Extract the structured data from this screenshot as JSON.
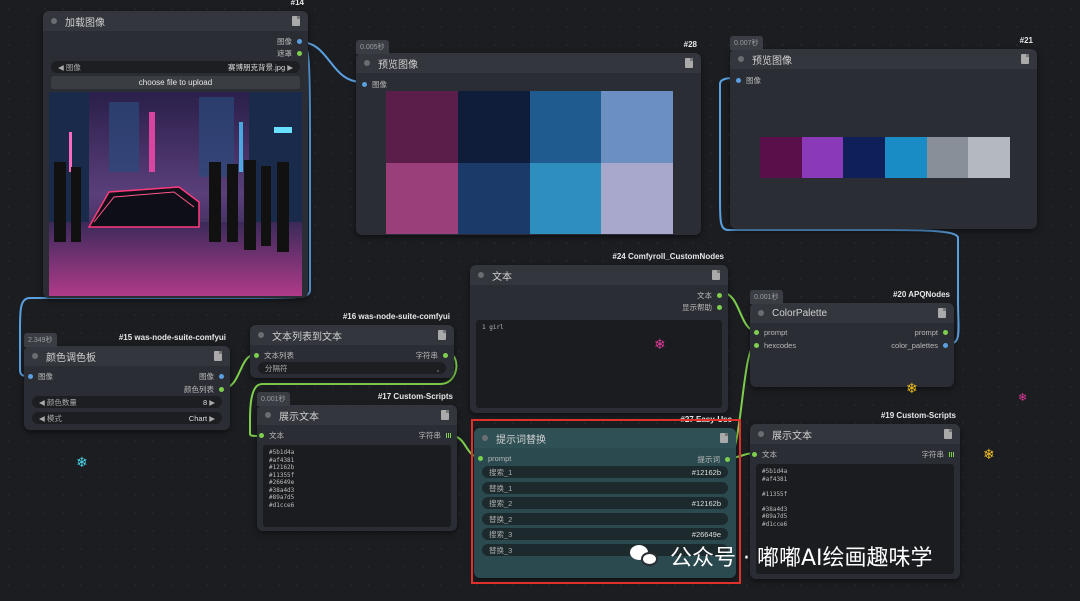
{
  "colors": {
    "highlight": "#e0302a",
    "wire_blue": "#5aa0e0",
    "wire_green": "#7ecf4d"
  },
  "load_image": {
    "id": "#14",
    "title": "加载图像",
    "out_image": "图像",
    "out_mask": "遮罩",
    "image_label": "图像",
    "image_value": "赛博朋克背景.jpg",
    "upload_button": "choose file to upload"
  },
  "preview28": {
    "id": "#28",
    "timer": "0.005秒",
    "title": "预览图像",
    "in_image": "图像",
    "swatches": [
      "#5b1d4a",
      "#0f1c3a",
      "#1f5b8f",
      "#6a8fc0",
      "#9a3f7a",
      "#1b3a6a",
      "#2e8fbf",
      "#a8a8cc"
    ]
  },
  "preview21": {
    "id": "#21",
    "timer": "0.007秒",
    "title": "预览图像",
    "in_image": "图像",
    "swatches": [
      "#5b0f4a",
      "#8a3ab9",
      "#0f1f5a",
      "#1a8cc5",
      "#888f99",
      "#b4b8c0"
    ]
  },
  "palette15": {
    "id": "#15 was-node-suite-comfyui",
    "timer": "2.349秒",
    "title": "颜色调色板",
    "in_image": "图像",
    "out_image": "图像",
    "out_list": "颜色列表",
    "count_label": "颜色数量",
    "count_value": "8",
    "mode_label": "模式",
    "mode_value": "Chart"
  },
  "list16": {
    "id": "#16 was-node-suite-comfyui",
    "title": "文本列表到文本",
    "in_list": "文本列表",
    "out_str": "字符串",
    "sep_label": "分隔符",
    "sep_value": ","
  },
  "text24": {
    "id": "#24 Comfyroll_CustomNodes",
    "title": "文本",
    "out_text": "文本",
    "out_help": "显示帮助",
    "content": "1 girl"
  },
  "show17": {
    "id": "#17 Custom-Scripts",
    "timer": "0.001秒",
    "title": "展示文本",
    "in_text": "文本",
    "out_str": "字符串",
    "content": "#5b1d4a\n#af4381\n#12162b\n#11355f\n#26649e\n#38a4d3\n#89a7d5\n#d1cce6"
  },
  "replace27": {
    "id": "#27 Easy-Use",
    "title": "提示词替换",
    "in_prompt": "prompt",
    "out_prompt": "提示词",
    "rows": [
      {
        "label": "搜索_1",
        "value": "#12162b"
      },
      {
        "label": "替换_1",
        "value": ""
      },
      {
        "label": "搜索_2",
        "value": "#12162b"
      },
      {
        "label": "替换_2",
        "value": ""
      },
      {
        "label": "搜索_3",
        "value": "#26649e"
      },
      {
        "label": "替换_3",
        "value": ""
      }
    ]
  },
  "colorpalette20": {
    "id": "#20 APQNodes",
    "timer": "0.001秒",
    "title": "ColorPalette",
    "in_prompt": "prompt",
    "in_hex": "hexcodes",
    "out_prompt": "prompt",
    "out_palettes": "color_palettes"
  },
  "show19": {
    "id": "#19 Custom-Scripts",
    "title": "展示文本",
    "in_text": "文本",
    "out_str": "字符串",
    "content": "#5b1d4a\n#af4381\n\n#11355f\n\n#38a4d3\n#89a7d5\n#d1cce6"
  },
  "watermark": "公众号 · 嘟嘟AI绘画趣味学"
}
